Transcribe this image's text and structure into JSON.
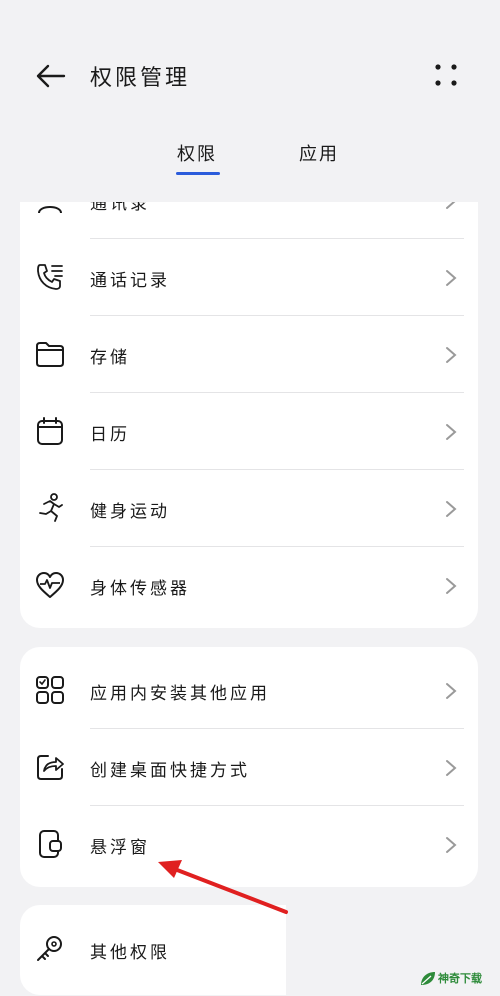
{
  "header": {
    "title": "权限管理"
  },
  "tabs": [
    {
      "label": "权限",
      "active": true
    },
    {
      "label": "应用",
      "active": false
    }
  ],
  "card1": [
    {
      "label": "通讯录",
      "icon": "contacts-icon"
    },
    {
      "label": "通话记录",
      "icon": "call-log-icon"
    },
    {
      "label": "存储",
      "icon": "folder-icon"
    },
    {
      "label": "日历",
      "icon": "calendar-icon"
    },
    {
      "label": "健身运动",
      "icon": "running-icon"
    },
    {
      "label": "身体传感器",
      "icon": "heart-rate-icon"
    }
  ],
  "card2": [
    {
      "label": "应用内安装其他应用",
      "icon": "apps-grid-icon"
    },
    {
      "label": "创建桌面快捷方式",
      "icon": "shortcut-share-icon"
    },
    {
      "label": "悬浮窗",
      "icon": "floating-window-icon"
    }
  ],
  "card3": [
    {
      "label": "其他权限",
      "icon": "key-icon"
    }
  ],
  "colors": {
    "accent": "#2b5cdb",
    "annotation_arrow": "#e02020"
  },
  "watermark": {
    "text": "神奇下载"
  }
}
